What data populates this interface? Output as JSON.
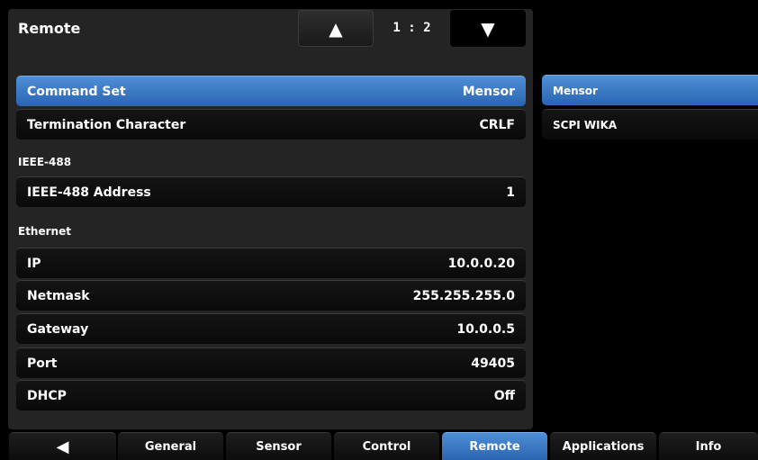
{
  "header": {
    "title": "Remote",
    "up_arrow": "▲",
    "page_indicator": "1 : 2",
    "down_arrow": "▼"
  },
  "rows": [
    {
      "label": "Command Set",
      "value": "Mensor"
    },
    {
      "label": "Termination Character",
      "value": "CRLF"
    },
    {
      "label": "IEEE-488 Address",
      "value": "1"
    },
    {
      "label": "IP",
      "value": "10.0.0.20"
    },
    {
      "label": "Netmask",
      "value": "255.255.255.0"
    },
    {
      "label": "Gateway",
      "value": "10.0.0.5"
    },
    {
      "label": "Port",
      "value": "49405"
    },
    {
      "label": "DHCP",
      "value": "Off"
    }
  ],
  "sections": {
    "ieee": "IEEE-488",
    "ethernet": "Ethernet"
  },
  "options": [
    "Mensor",
    "SCPI WIKA"
  ],
  "tabs": {
    "back": "◀",
    "items": [
      "General",
      "Sensor",
      "Control",
      "Remote",
      "Applications",
      "Info"
    ],
    "active": "Remote"
  },
  "colors": {
    "accent": "#3d7cc9",
    "background": "#000000",
    "panel": "#242424"
  }
}
